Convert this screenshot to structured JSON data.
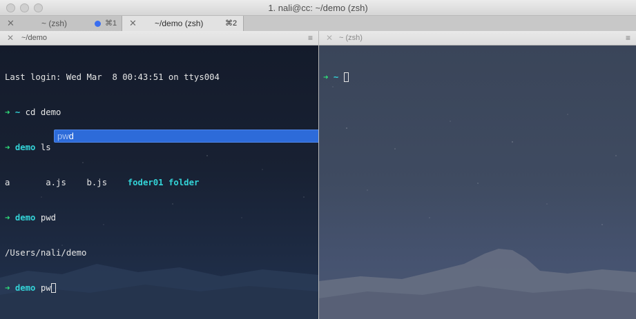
{
  "window": {
    "title": "1. nali@cc: ~/demo (zsh)"
  },
  "tabs": [
    {
      "close": "✕",
      "label": "~ (zsh)",
      "shortcut": "⌘1",
      "has_activity_dot": true
    },
    {
      "close": "✕",
      "label": "~/demo (zsh)",
      "shortcut": "⌘2"
    }
  ],
  "panes": {
    "left": {
      "header_close": "✕",
      "header_label": "~/demo",
      "header_menu": "≡"
    },
    "right": {
      "header_close": "✕",
      "header_label": "~ (zsh)",
      "header_menu": "≡"
    }
  },
  "terminal_left": {
    "login_line": "Last login: Wed Mar  8 00:43:51 on ttys004",
    "prompt_arrow": "➜",
    "lines": [
      {
        "cwd": "~",
        "command": "cd demo"
      },
      {
        "cwd": "demo",
        "command": "ls"
      }
    ],
    "ls_output": {
      "plain": [
        "a",
        "a.js",
        "b.js"
      ],
      "dirs": [
        "foder01",
        "folder"
      ]
    },
    "pwd_prompt": {
      "cwd": "demo",
      "command": "pwd"
    },
    "pwd_output": "/Users/nali/demo",
    "current_prompt": {
      "cwd": "demo",
      "input": "pw"
    }
  },
  "autocomplete": {
    "typed": "pw",
    "completion": "d"
  },
  "terminal_right": {
    "prompt_arrow": "➜",
    "cwd": "~"
  },
  "colors": {
    "prompt_arrow": "#2fe07a",
    "cwd": "#33d4d8",
    "autocomplete_bg": "#2d6bd9",
    "tab_dot": "#3a6ef0"
  }
}
